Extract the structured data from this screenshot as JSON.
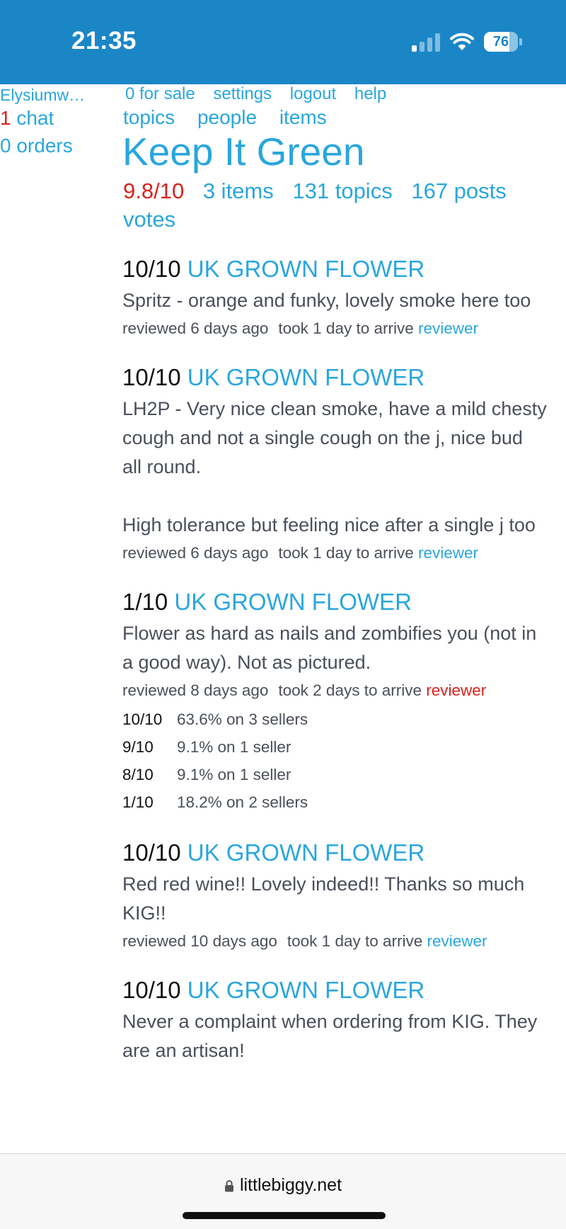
{
  "status_bar": {
    "time": "21:35",
    "battery": "76",
    "battery_level": 0.76
  },
  "sidebar": {
    "username": "Elysiumw…",
    "chat_count": "1",
    "chat_label": " chat",
    "orders": "0 orders"
  },
  "nav": {
    "for_sale": "0 for sale",
    "settings": "settings",
    "logout": "logout",
    "help": "help",
    "topics": "topics",
    "people": "people",
    "items": "items"
  },
  "shop": {
    "title": "Keep It Green",
    "rating": "9.8/10",
    "items": "3 items",
    "topics": "131 topics",
    "posts": "167 posts",
    "votes": "votes"
  },
  "reviews": [
    {
      "score": "10/10",
      "item": "UK GROWN FLOWER",
      "text": "Spritz - orange and funky, lovely smoke here too",
      "reviewed": "reviewed 6 days ago",
      "arrival": "took 1 day to arrive",
      "reviewer": "reviewer"
    },
    {
      "score": "10/10",
      "item": "UK GROWN FLOWER",
      "text": "LH2P - Very nice clean smoke, have a mild chesty cough and not a single cough on the j, nice bud all round.\n\nHigh tolerance but feeling nice after a single j too",
      "reviewed": "reviewed 6 days ago",
      "arrival": "took 1 day to arrive",
      "reviewer": "reviewer"
    },
    {
      "score": "1/10",
      "item": "UK GROWN FLOWER",
      "text": "Flower as hard as nails and zombifies you (not in a good way). Not as pictured.",
      "reviewed": "reviewed 8 days ago",
      "arrival": "took 2 days to arrive",
      "reviewer": "reviewer"
    },
    {
      "score": "10/10",
      "item": "UK GROWN FLOWER",
      "text": "Red red wine!! Lovely indeed!! Thanks so much KIG!!",
      "reviewed": "reviewed 10 days ago",
      "arrival": "took 1 day to arrive",
      "reviewer": "reviewer"
    },
    {
      "score": "10/10",
      "item": "UK GROWN FLOWER",
      "text": "Never a complaint when ordering from KIG. They are an artisan!",
      "reviewed": "",
      "arrival": "",
      "reviewer": ""
    }
  ],
  "distribution": [
    {
      "score": "10/10",
      "value": "63.6% on 3 sellers"
    },
    {
      "score": "9/10",
      "value": "9.1% on 1 seller"
    },
    {
      "score": "8/10",
      "value": "9.1% on 1 seller"
    },
    {
      "score": "1/10",
      "value": "18.2% on 2 sellers"
    }
  ],
  "browser": {
    "url": "littlebiggy.net"
  },
  "colors": {
    "header": "#1b86c6",
    "link": "#2aa6dc",
    "alert": "#d9221c"
  }
}
